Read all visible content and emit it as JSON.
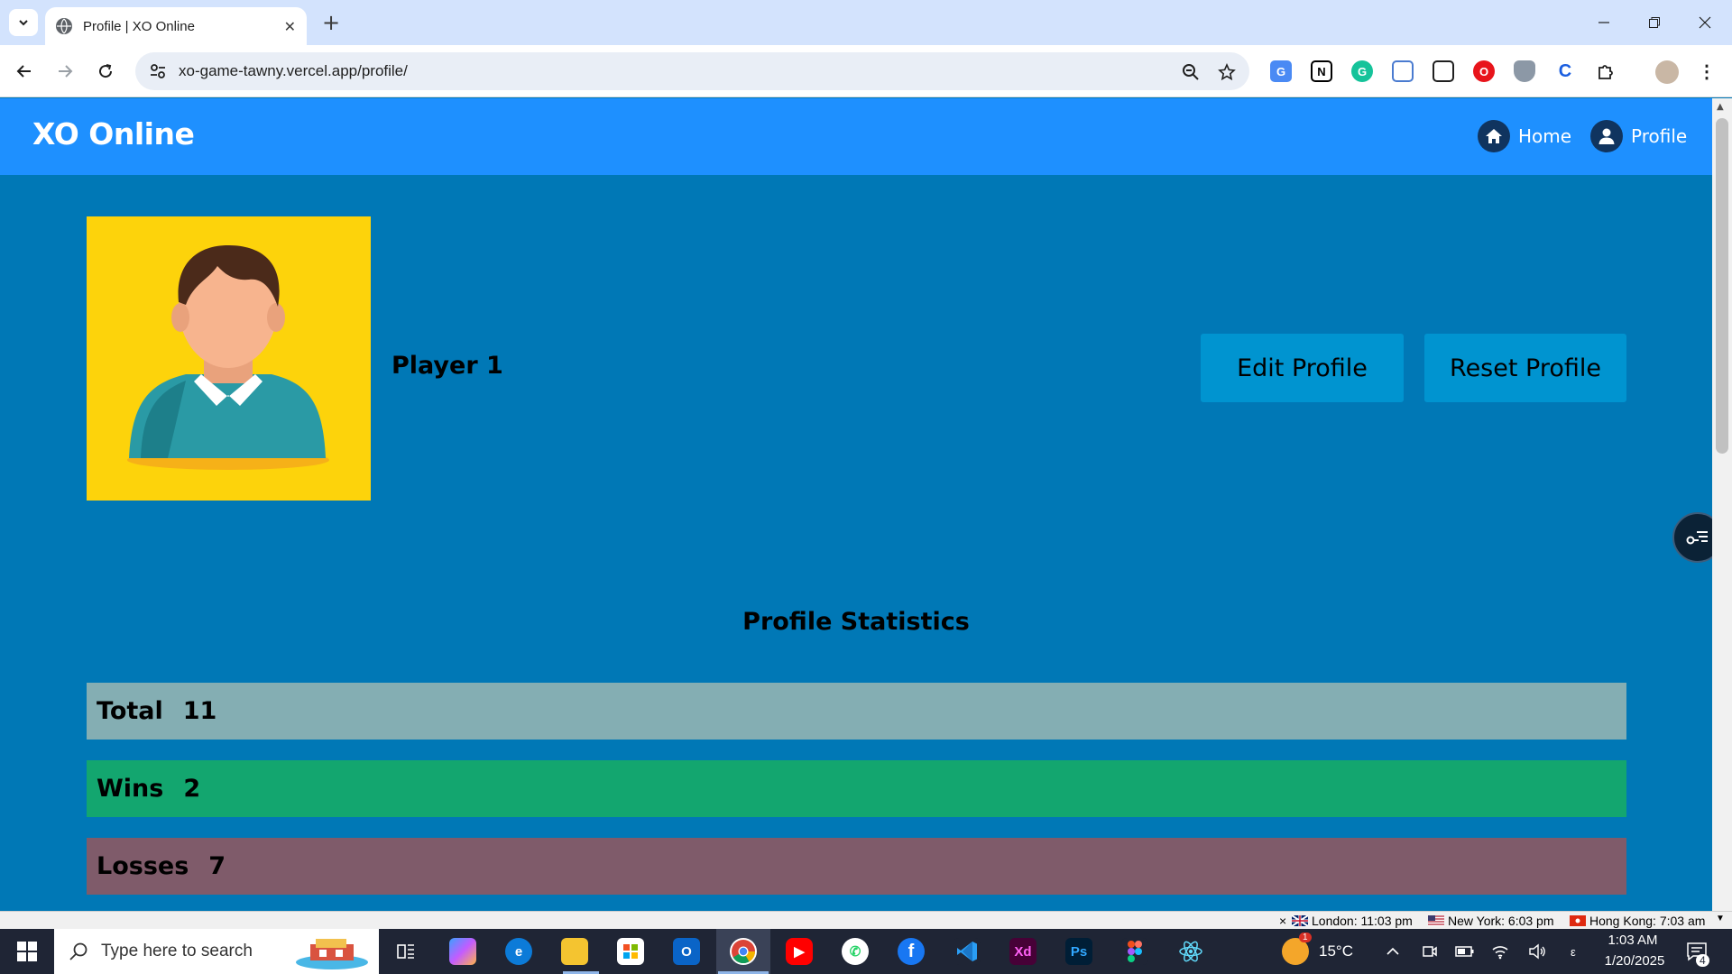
{
  "browser": {
    "tab_title": "Profile | XO Online",
    "url": "xo-game-tawny.vercel.app/profile/"
  },
  "app": {
    "logo": "XO Online",
    "nav": [
      {
        "label": "Home",
        "icon": "home-icon"
      },
      {
        "label": "Profile",
        "icon": "user-icon"
      }
    ]
  },
  "profile": {
    "player_name": "Player 1",
    "edit_button": "Edit Profile",
    "reset_button": "Reset Profile",
    "stats_title": "Profile Statistics",
    "stats": [
      {
        "label": "Total",
        "value": "11",
        "color": "#84aeb3"
      },
      {
        "label": "Wins",
        "value": "2",
        "color": "#13a66f"
      },
      {
        "label": "Losses",
        "value": "7",
        "color": "#7f5b6a"
      }
    ]
  },
  "world_clocks": [
    {
      "label": "London: 11:03 pm"
    },
    {
      "label": "New York: 6:03 pm"
    },
    {
      "label": "Hong Kong: 7:03 am"
    }
  ],
  "taskbar": {
    "search_placeholder": "Type here to search",
    "temperature": "15°C",
    "time": "1:03 AM",
    "date": "1/20/2025",
    "notification_count": "4",
    "weather_badge": "1"
  },
  "colors": {
    "header": "#1e90ff",
    "content_bg": "#0078b6",
    "button_bg": "#0094d0",
    "avatar_bg": "#fdd30b"
  }
}
